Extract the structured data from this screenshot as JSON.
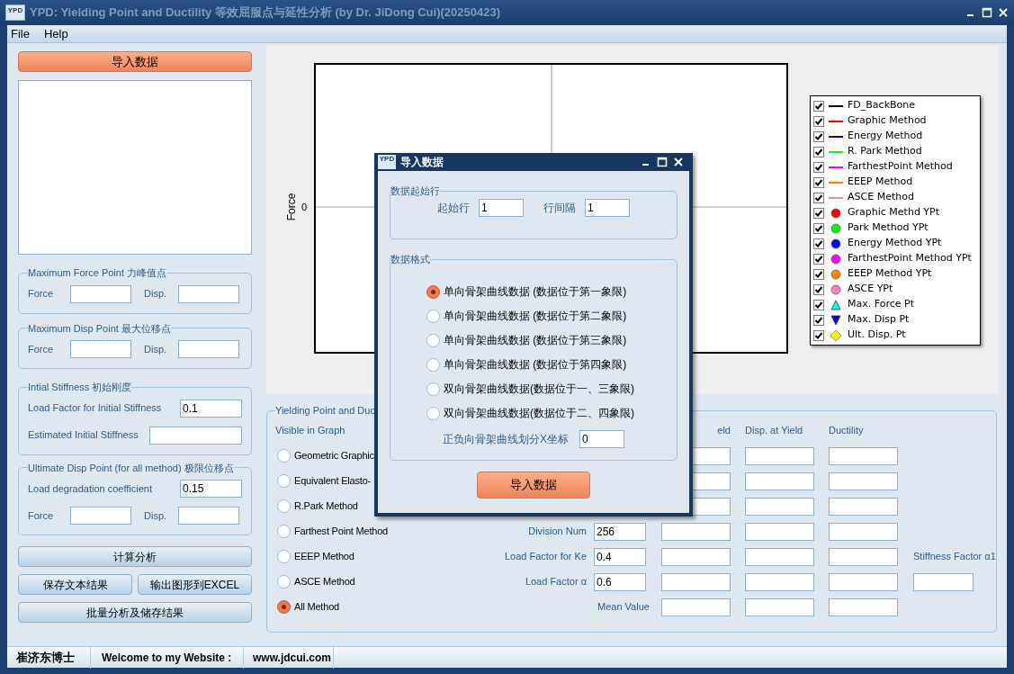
{
  "window": {
    "title": "YPD: Yielding Point and Ductility 等效屈服点与延性分析 (by Dr. JiDong Cui)(20250423)",
    "icon_label": "YPD"
  },
  "menu": [
    {
      "label": "File"
    },
    {
      "label": "Help"
    }
  ],
  "left_panel": {
    "import_button": "导入数据",
    "groups": [
      {
        "title": "Maximum Force Point 力峰值点",
        "rows": [
          [
            {
              "label": "Force"
            },
            {
              "label": "Disp."
            }
          ]
        ]
      },
      {
        "title": "Maximum Disp Point 最大位移点",
        "rows": [
          [
            {
              "label": "Force"
            },
            {
              "label": "Disp."
            }
          ]
        ]
      },
      {
        "title": "Intial Stiffness 初始刚度",
        "rows": [
          [
            {
              "label": "Load Factor for Initial Stiffness",
              "value": "0.1"
            }
          ],
          [
            {
              "label": "Estimated Initial Stiffness"
            }
          ]
        ]
      },
      {
        "title": "Ultimate Disp  Point (for all method) 极限位移点",
        "rows": [
          [
            {
              "label": "Load degradation coefficient",
              "value": "0.15"
            }
          ],
          [
            {
              "label": "Force"
            },
            {
              "label": "Disp."
            }
          ]
        ]
      }
    ],
    "buttons": [
      [
        "计算分析"
      ],
      [
        "保存文本结果",
        "输出图形到EXCEL"
      ],
      [
        "批量分析及储存结果"
      ]
    ]
  },
  "chart": {
    "ylabel": "Force",
    "y_tick": "0",
    "legend": [
      {
        "label": "FD_BackBone",
        "kind": "line",
        "color": "#000000",
        "checked": true
      },
      {
        "label": "Graphic Method",
        "kind": "line",
        "color": "#ff0000",
        "checked": true
      },
      {
        "label": "Energy Method",
        "kind": "line",
        "color": "#0000ff",
        "checked": true
      },
      {
        "label": "R. Park Method",
        "kind": "line",
        "color": "#00ff00",
        "checked": true
      },
      {
        "label": "FarthestPoint Method",
        "kind": "line",
        "color": "#ff00ff",
        "checked": true
      },
      {
        "label": "EEEP Method",
        "kind": "line",
        "color": "#ff8000",
        "checked": true
      },
      {
        "label": "ASCE Method",
        "kind": "line",
        "color": "#ff80c0",
        "checked": true
      },
      {
        "label": "Graphic Methd YPt",
        "kind": "circle",
        "color": "#ff0000",
        "checked": true
      },
      {
        "label": "Park Method YPt",
        "kind": "circle",
        "color": "#00ff00",
        "checked": true
      },
      {
        "label": "Energy Method YPt",
        "kind": "circle",
        "color": "#0000ff",
        "checked": true
      },
      {
        "label": "FarthestPoint Method YPt",
        "kind": "circle",
        "color": "#ff00ff",
        "checked": true
      },
      {
        "label": "EEEP Method YPt",
        "kind": "circle",
        "color": "#ff8000",
        "checked": true
      },
      {
        "label": "ASCE YPt",
        "kind": "circle",
        "color": "#ff80c0",
        "checked": true
      },
      {
        "label": "Max. Force Pt",
        "kind": "triangle_up",
        "color": "#00ffff",
        "checked": true
      },
      {
        "label": "Max. Disp Pt",
        "kind": "triangle_down",
        "color": "#0000ff",
        "checked": true
      },
      {
        "label": "Ult. Disp. Pt",
        "kind": "diamond",
        "color": "#ffff00",
        "checked": true
      }
    ]
  },
  "results": {
    "title": "Yielding Point and Duc",
    "visible_label": "Visible in Graph",
    "methods": [
      {
        "label": "Geometric Graphic",
        "selected": false
      },
      {
        "label": "Equivalent Elasto-",
        "selected": false
      },
      {
        "label": "R.Park Method",
        "selected": false
      },
      {
        "label": "Farthest Point Method",
        "selected": false
      },
      {
        "label": "EEEP Method",
        "selected": false
      },
      {
        "label": "ASCE Method",
        "selected": false
      },
      {
        "label": "All Method",
        "selected": true
      }
    ],
    "columns": [
      "eld",
      "Disp. at Yield",
      "Ductility"
    ],
    "rows": [
      {
        "kind": "plain"
      },
      {
        "kind": "plain"
      },
      {
        "kind": "plain"
      },
      {
        "kind": "param",
        "label": "Division Num",
        "value": "256"
      },
      {
        "kind": "param",
        "label": "Load Factor for Ke",
        "value": "0.4",
        "extra": {
          "kind": "label",
          "text": "Stiffness Factor α1"
        }
      },
      {
        "kind": "param",
        "label": "Load Factor α",
        "value": "0.6",
        "extra": {
          "kind": "field"
        }
      },
      {
        "kind": "mean",
        "caption": "Mean Value"
      }
    ]
  },
  "dialog": {
    "title": "导入数据",
    "icon_label": "YPD",
    "start_group": {
      "title": "数据起始行",
      "fields": [
        {
          "label": "起始行",
          "value": "1"
        },
        {
          "label": "行间隔",
          "value": "1"
        }
      ]
    },
    "format_group": {
      "title": "数据格式",
      "options": [
        {
          "label": "单向骨架曲线数据 (数据位于第一象限)",
          "selected": true
        },
        {
          "label": "单向骨架曲线数据 (数据位于第二象限)",
          "selected": false
        },
        {
          "label": "单向骨架曲线数据 (数据位于第三象限)",
          "selected": false
        },
        {
          "label": "单向骨架曲线数据 (数据位于第四象限)",
          "selected": false
        },
        {
          "label": "双向骨架曲线数据(数据位于一、三象限)",
          "selected": false
        },
        {
          "label": "双向骨架曲线数据(数据位于二、四象限)",
          "selected": false
        }
      ],
      "split": {
        "label": "正负向骨架曲线划分X坐标",
        "value": "0"
      }
    },
    "button": "导入数据"
  },
  "status_bar": [
    "崔济东博士",
    "Welcome to my Website :",
    "www.jdcui.com"
  ]
}
